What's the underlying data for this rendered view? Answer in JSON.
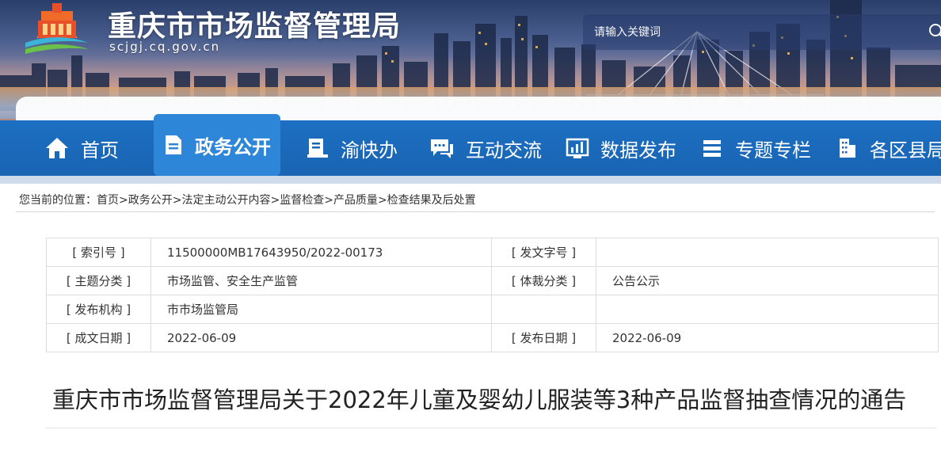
{
  "header": {
    "site_title": "重庆市市场监督管理局",
    "site_domain": "scjgj.cq.gov.cn",
    "search_placeholder": "请输入关键词"
  },
  "nav": {
    "items": [
      {
        "label": "首页",
        "icon": "home-icon"
      },
      {
        "label": "政务公开",
        "icon": "document-icon",
        "active": true
      },
      {
        "label": "渝快办",
        "icon": "service-icon"
      },
      {
        "label": "互动交流",
        "icon": "chat-icon"
      },
      {
        "label": "数据发布",
        "icon": "chart-icon"
      },
      {
        "label": "专题专栏",
        "icon": "stack-icon"
      },
      {
        "label": "各区县局",
        "icon": "building-icon"
      }
    ]
  },
  "breadcrumb": {
    "prefix": "您当前的位置：",
    "items": [
      "首页",
      "政务公开",
      "法定主动公开内容",
      "监督检查",
      "产品质量",
      "检查结果及后处置"
    ],
    "separator": ">"
  },
  "info": {
    "index_no_label": "[ 索引号 ]",
    "index_no_value": "11500000MB17643950/2022-00173",
    "doc_no_label": "[ 发文字号 ]",
    "doc_no_value": "",
    "topic_label": "[ 主题分类 ]",
    "topic_value": "市场监管、安全生产监管",
    "genre_label": "[ 体裁分类 ]",
    "genre_value": "公告公示",
    "issuer_label": "[ 发布机构 ]",
    "issuer_value": "市市场监管局",
    "written_label": "[ 成文日期 ]",
    "written_value": "2022-06-09",
    "published_label": "[ 发布日期 ]",
    "published_value": "2022-06-09"
  },
  "document": {
    "title": "重庆市市场监督管理局关于2022年儿童及婴幼儿服装等3种产品监督抽查情况的通告"
  },
  "colors": {
    "nav_blue": "#1a64b3",
    "nav_active": "#2d86d8"
  }
}
